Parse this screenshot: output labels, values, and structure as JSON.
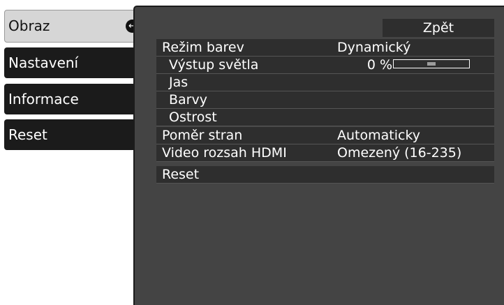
{
  "sidebar": {
    "items": [
      {
        "label": "Obraz",
        "active": true
      },
      {
        "label": "Nastavení"
      },
      {
        "label": "Informace"
      },
      {
        "label": "Reset"
      }
    ]
  },
  "panel": {
    "back_label": "Zpět",
    "rows": [
      {
        "label": "Režim barev",
        "value": "Dynamický"
      },
      {
        "label": "Výstup světla",
        "value": "0 %",
        "slider_level": 0.5
      },
      {
        "label": "Jas"
      },
      {
        "label": "Barvy"
      },
      {
        "label": "Ostrost"
      },
      {
        "label": "Poměr stran",
        "value": "Automaticky"
      },
      {
        "label": "Video rozsah HDMI",
        "value": "Omezený (16-235)"
      },
      {
        "label": "Reset"
      }
    ]
  },
  "icons": {
    "enter": "enter-icon"
  },
  "colors": {
    "panel_bg": "#444444",
    "row_bg": "#2e2e2e",
    "tab_bg": "#1b1b1b",
    "active_tab_bg": "#d6d6d6"
  }
}
